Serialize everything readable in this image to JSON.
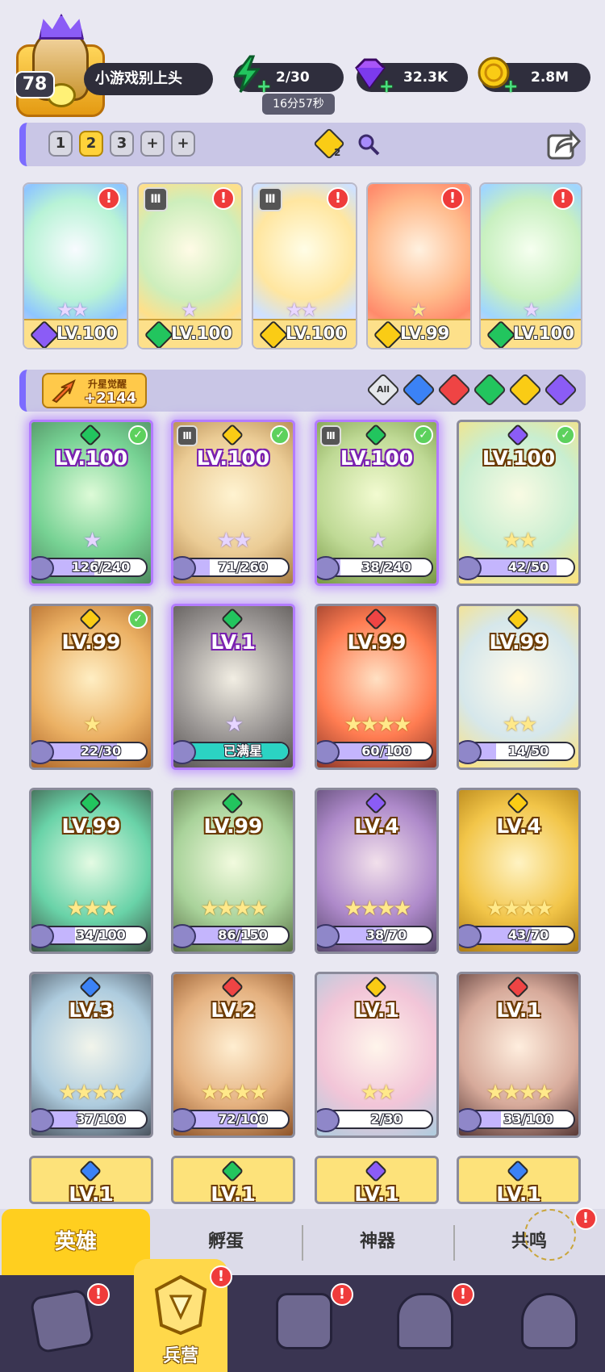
{
  "player": {
    "level": "78",
    "name": "小游戏别上头"
  },
  "resources": [
    {
      "name": "energy",
      "value": "2/30",
      "icon": "lightning-icon",
      "color": "#22c55e"
    },
    {
      "name": "gems",
      "value": "32.3K",
      "icon": "diamond-icon",
      "color": "#a855f7"
    },
    {
      "name": "coins",
      "value": "2.8M",
      "icon": "coin-icon",
      "color": "#facc15"
    }
  ],
  "energy_timer": "16分57秒",
  "team_tabs": [
    "1",
    "2",
    "3",
    "+",
    "+"
  ],
  "active_team": 1,
  "team_power_badge": "2",
  "team": [
    {
      "level": "LV.100",
      "element": "dark",
      "stars": "★★",
      "alert": "!"
    },
    {
      "level": "LV.100",
      "element": "nature",
      "stars": "★",
      "alert": "!"
    },
    {
      "level": "LV.100",
      "element": "light",
      "stars": "★★",
      "alert": "!"
    },
    {
      "level": "LV.99",
      "element": "light",
      "stars": "★",
      "alert": "!"
    },
    {
      "level": "LV.100",
      "element": "nature",
      "stars": "★",
      "alert": "!"
    }
  ],
  "awaken": {
    "label": "升星觉醒",
    "value": "+2144"
  },
  "filters": [
    {
      "label": "All",
      "color": "#e5e7eb"
    },
    {
      "label": "",
      "color": "#3b82f6"
    },
    {
      "label": "",
      "color": "#ef4444"
    },
    {
      "label": "",
      "color": "#22c55e"
    },
    {
      "label": "",
      "color": "#facc15"
    },
    {
      "label": "",
      "color": "#8b5cf6"
    }
  ],
  "heroes": [
    {
      "level": "LV.100",
      "progress": "126/240",
      "fill": 0.525,
      "element": "#22c55e",
      "check": true,
      "tag": false,
      "style": "purple",
      "stars": "★",
      "full": false
    },
    {
      "level": "LV.100",
      "progress": "71/260",
      "fill": 0.273,
      "element": "#facc15",
      "check": true,
      "tag": true,
      "style": "purple",
      "stars": "★★",
      "full": false
    },
    {
      "level": "LV.100",
      "progress": "38/240",
      "fill": 0.158,
      "element": "#22c55e",
      "check": true,
      "tag": true,
      "style": "purple",
      "stars": "★",
      "full": false
    },
    {
      "level": "LV.100",
      "progress": "42/50",
      "fill": 0.84,
      "element": "#8b5cf6",
      "check": true,
      "tag": false,
      "style": "gold",
      "stars": "★★",
      "full": false
    },
    {
      "level": "LV.99",
      "progress": "22/30",
      "fill": 0.733,
      "element": "#facc15",
      "check": true,
      "tag": false,
      "style": "gold",
      "stars": "★",
      "full": false
    },
    {
      "level": "LV.1",
      "progress": "已满星",
      "fill": 1,
      "element": "#22c55e",
      "check": false,
      "tag": false,
      "style": "purple",
      "stars": "★",
      "full": true
    },
    {
      "level": "LV.99",
      "progress": "60/100",
      "fill": 0.6,
      "element": "#ef4444",
      "check": false,
      "tag": false,
      "style": "gold",
      "stars": "★★★★",
      "full": false
    },
    {
      "level": "LV.99",
      "progress": "14/50",
      "fill": 0.28,
      "element": "#facc15",
      "check": false,
      "tag": false,
      "style": "gold",
      "stars": "★★",
      "full": false
    },
    {
      "level": "LV.99",
      "progress": "34/100",
      "fill": 0.34,
      "element": "#22c55e",
      "check": false,
      "tag": false,
      "style": "gold",
      "stars": "★★★",
      "full": false
    },
    {
      "level": "LV.99",
      "progress": "86/150",
      "fill": 0.573,
      "element": "#22c55e",
      "check": false,
      "tag": false,
      "style": "gold",
      "stars": "★★★★",
      "full": false
    },
    {
      "level": "LV.4",
      "progress": "38/70",
      "fill": 0.543,
      "element": "#8b5cf6",
      "check": false,
      "tag": false,
      "style": "gold",
      "stars": "★★★★",
      "full": false
    },
    {
      "level": "LV.4",
      "progress": "43/70",
      "fill": 0.614,
      "element": "#facc15",
      "check": false,
      "tag": false,
      "style": "gold",
      "stars": "★★★★",
      "full": false
    },
    {
      "level": "LV.3",
      "progress": "37/100",
      "fill": 0.37,
      "element": "#3b82f6",
      "check": false,
      "tag": false,
      "style": "gold",
      "stars": "★★★★",
      "full": false
    },
    {
      "level": "LV.2",
      "progress": "72/100",
      "fill": 0.72,
      "element": "#ef4444",
      "check": false,
      "tag": false,
      "style": "gold",
      "stars": "★★★★",
      "full": false
    },
    {
      "level": "LV.1",
      "progress": "2/30",
      "fill": 0.067,
      "element": "#facc15",
      "check": false,
      "tag": false,
      "style": "gold",
      "stars": "★★",
      "full": false
    },
    {
      "level": "LV.1",
      "progress": "33/100",
      "fill": 0.33,
      "element": "#ef4444",
      "check": false,
      "tag": false,
      "style": "gold",
      "stars": "★★★★",
      "full": false
    },
    {
      "level": "LV.1",
      "progress": "",
      "fill": 0,
      "element": "#3b82f6",
      "check": false,
      "tag": false,
      "style": "gold",
      "stars": "",
      "full": false
    },
    {
      "level": "LV.1",
      "progress": "",
      "fill": 0,
      "element": "#22c55e",
      "check": false,
      "tag": false,
      "style": "gold",
      "stars": "",
      "full": false
    },
    {
      "level": "LV.1",
      "progress": "",
      "fill": 0,
      "element": "#8b5cf6",
      "check": false,
      "tag": false,
      "style": "gold",
      "stars": "",
      "full": false
    },
    {
      "level": "LV.1",
      "progress": "",
      "fill": 0,
      "element": "#3b82f6",
      "check": false,
      "tag": false,
      "style": "gold",
      "stars": "",
      "full": false
    }
  ],
  "tabs": [
    "英雄",
    "孵蛋",
    "神器",
    "共鸣"
  ],
  "nav": [
    {
      "label": "",
      "icon": "cards-icon",
      "alert": "!"
    },
    {
      "label": "兵营",
      "icon": "barracks-icon",
      "alert": "!"
    },
    {
      "label": "",
      "icon": "map-icon",
      "alert": "!"
    },
    {
      "label": "",
      "icon": "shop-icon",
      "alert": "!"
    },
    {
      "label": "",
      "icon": "guild-icon",
      "alert": ""
    }
  ],
  "resonance_alert": "!"
}
